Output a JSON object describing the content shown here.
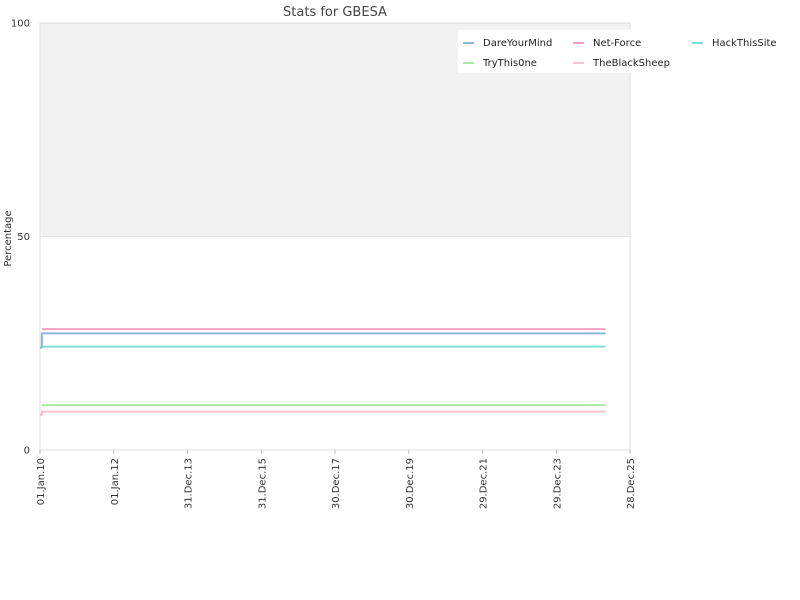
{
  "chart_data": {
    "type": "line",
    "title": "Stats for GBESA",
    "ylabel": "Percentage",
    "xlabel": "",
    "ylim": [
      0,
      100
    ],
    "yticks": [
      0,
      50,
      100
    ],
    "xlim": [
      "2010-01-01",
      "2025-12-28"
    ],
    "xticks": [
      "01.Jan.10",
      "01.Jan.12",
      "31.Dec.13",
      "31.Dec.15",
      "30.Dec.17",
      "30.Dec.19",
      "29.Dec.21",
      "29.Dec.23",
      "28.Dec.25"
    ],
    "xtick_dates": [
      "2010-01-01",
      "2012-01-01",
      "2013-12-31",
      "2015-12-31",
      "2017-12-30",
      "2019-12-30",
      "2021-12-29",
      "2023-12-29",
      "2025-12-28"
    ],
    "upper_band_color": "#f2f2f2",
    "legend_position": "top-right",
    "series": [
      {
        "name": "DareYourMind",
        "color": "#8ab8d8",
        "x": [
          "2010-01-01",
          "2010-01-20",
          "2010-01-20",
          "2025-04-30"
        ],
        "y": [
          24,
          24,
          27.3,
          27.3
        ]
      },
      {
        "name": "Net-Force",
        "color": "#f0a0c0",
        "x": [
          "2010-01-20",
          "2025-04-30"
        ],
        "y": [
          28.3,
          28.3
        ]
      },
      {
        "name": "HackThisSite",
        "color": "#80e0d0",
        "x": [
          "2010-01-20",
          "2025-04-30"
        ],
        "y": [
          24.2,
          24.2
        ]
      },
      {
        "name": "TryThis0ne",
        "color": "#a8eca0",
        "x": [
          "2010-01-20",
          "2025-04-30"
        ],
        "y": [
          10.5,
          10.5
        ]
      },
      {
        "name": "TheBlackSheep",
        "color": "#f4c4cc",
        "x": [
          "2010-01-01",
          "2010-01-20",
          "2010-01-20",
          "2025-04-30"
        ],
        "y": [
          8.2,
          8.2,
          9,
          9
        ]
      }
    ]
  }
}
